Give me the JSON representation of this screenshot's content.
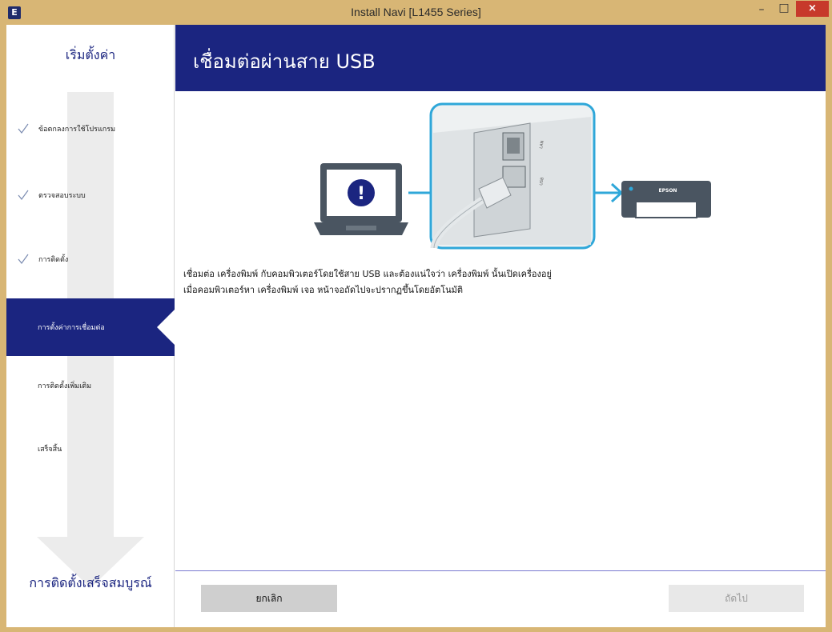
{
  "window": {
    "title": "Install Navi [L1455 Series]",
    "app_icon_letter": "E",
    "controls": {
      "minimize": "–",
      "maximize": "□",
      "close": "×"
    }
  },
  "sidebar": {
    "header": "เริ่มตั้งค่า",
    "steps": [
      {
        "label": "ข้อตกลงการใช้โปรแกรม",
        "status": "done"
      },
      {
        "label": "ตรวจสอบระบบ",
        "status": "done"
      },
      {
        "label": "การติดตั้ง",
        "status": "done"
      },
      {
        "label": "การตั้งค่าการเชื่อมต่อ",
        "status": "active"
      },
      {
        "label": "การติดตั้งเพิ่มเติม",
        "status": "pending"
      },
      {
        "label": "เสร็จสิ้น",
        "status": "pending"
      }
    ],
    "footer": "การติดตั้งเสร็จสมบูรณ์"
  },
  "main": {
    "title": "เชื่อมต่อผ่านสาย USB",
    "illustration": {
      "alert_glyph": "!",
      "port_labels": [
        "LAN",
        "USB"
      ],
      "printer_brand": "EPSON"
    },
    "instructions": [
      "เชื่อมต่อ เครื่องพิมพ์ กับคอมพิวเตอร์โดยใช้สาย USB และต้องแน่ใจว่า เครื่องพิมพ์ นั้นเปิดเครื่องอยู่",
      "เมื่อคอมพิวเตอร์หา เครื่องพิมพ์ เจอ หน้าจอถัดไปจะปรากฏขึ้นโดยอัตโนมัติ"
    ]
  },
  "footer": {
    "cancel_label": "ยกเลิก",
    "next_label": "ถัดไป"
  },
  "colors": {
    "brand_navy": "#1b2580",
    "accent_cyan": "#2fa7d9",
    "titlebar": "#d8b675",
    "close": "#c7392b"
  }
}
